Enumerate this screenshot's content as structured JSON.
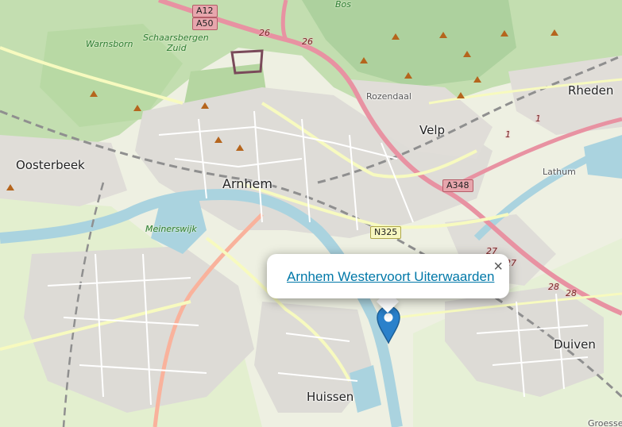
{
  "map": {
    "places": {
      "arnhem": "Arnhem",
      "oosterbeek": "Oosterbeek",
      "velp": "Velp",
      "rheden": "Rheden",
      "rozendaal": "Rozendaal",
      "lathum": "Lathum",
      "duiven": "Duiven",
      "huissen": "Huissen",
      "meinerswijk": "Meinerswijk",
      "warnsborn": "Warnsborn",
      "schaarsbergen_line1": "Schaarsbergen",
      "schaarsbergen_line2": "Zuid",
      "bos": "Bos",
      "groessen": "Groessen"
    },
    "roads": {
      "a12": "A12",
      "a50": "A50",
      "a348": "A348",
      "n325": "N325",
      "r26a": "26",
      "r26b": "26",
      "r1a": "1",
      "r1b": "1",
      "r27a": "27",
      "r27b": "27",
      "r28a": "28",
      "r28b": "28"
    },
    "colors": {
      "land": "#f2efe9",
      "urban": "#dcdad5",
      "forest": "#add19e",
      "meadow": "#cdebb0",
      "water": "#aad3df",
      "motorway": "#e892a2",
      "primary": "#f7fabf",
      "marker": "#2a81cb"
    }
  },
  "popup": {
    "link_text": "Arnhem Westervoort Uiterwaarden",
    "close_symbol": "×"
  },
  "marker": {
    "icon": "map-pin-icon"
  }
}
